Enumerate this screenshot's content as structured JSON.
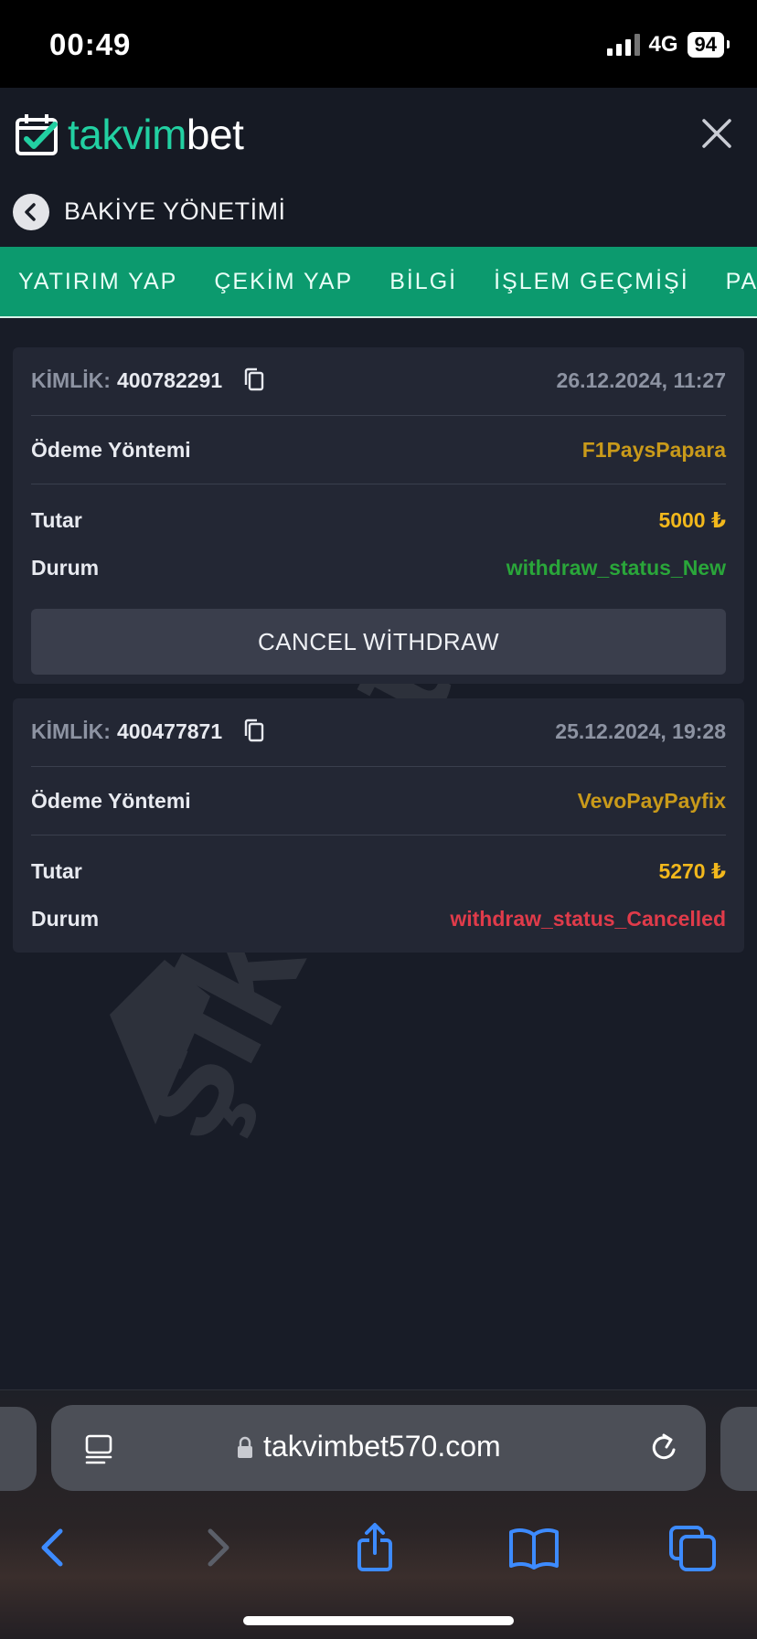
{
  "status_bar": {
    "time": "00:49",
    "network": "4G",
    "battery": "94"
  },
  "header": {
    "logo_part1": "takvim",
    "logo_part2": "bet"
  },
  "subheader": {
    "title": "BAKİYE YÖNETİMİ"
  },
  "tabs": [
    {
      "label": "YATIRIM YAP"
    },
    {
      "label": "ÇEKİM YAP"
    },
    {
      "label": "BİLGİ"
    },
    {
      "label": "İŞLEM GEÇMİŞİ"
    },
    {
      "label": "PAR"
    }
  ],
  "labels": {
    "kimlik": "KİMLİK:",
    "payment_method": "Ödeme Yöntemi",
    "amount": "Tutar",
    "status": "Durum"
  },
  "transactions": [
    {
      "id": "400782291",
      "date": "26.12.2024, 11:27",
      "method": "F1PaysPapara",
      "amount": "5000 ₺",
      "status": "withdraw_status_New",
      "status_color": "#2aa63a",
      "cancel_label": "CANCEL WİTHDRAW"
    },
    {
      "id": "400477871",
      "date": "25.12.2024, 19:28",
      "method": "VevoPayPayfix",
      "amount": "5270 ₺",
      "status": "withdraw_status_Cancelled",
      "status_color": "#e03b4a"
    }
  ],
  "colors": {
    "method": "#c99a1a",
    "amount": "#f2b81c",
    "accent": "#0c9a6e",
    "logo_accent": "#22d0a2"
  },
  "watermark": {
    "text": "şikayetvar"
  },
  "browser": {
    "url": "takvimbet570.com"
  }
}
